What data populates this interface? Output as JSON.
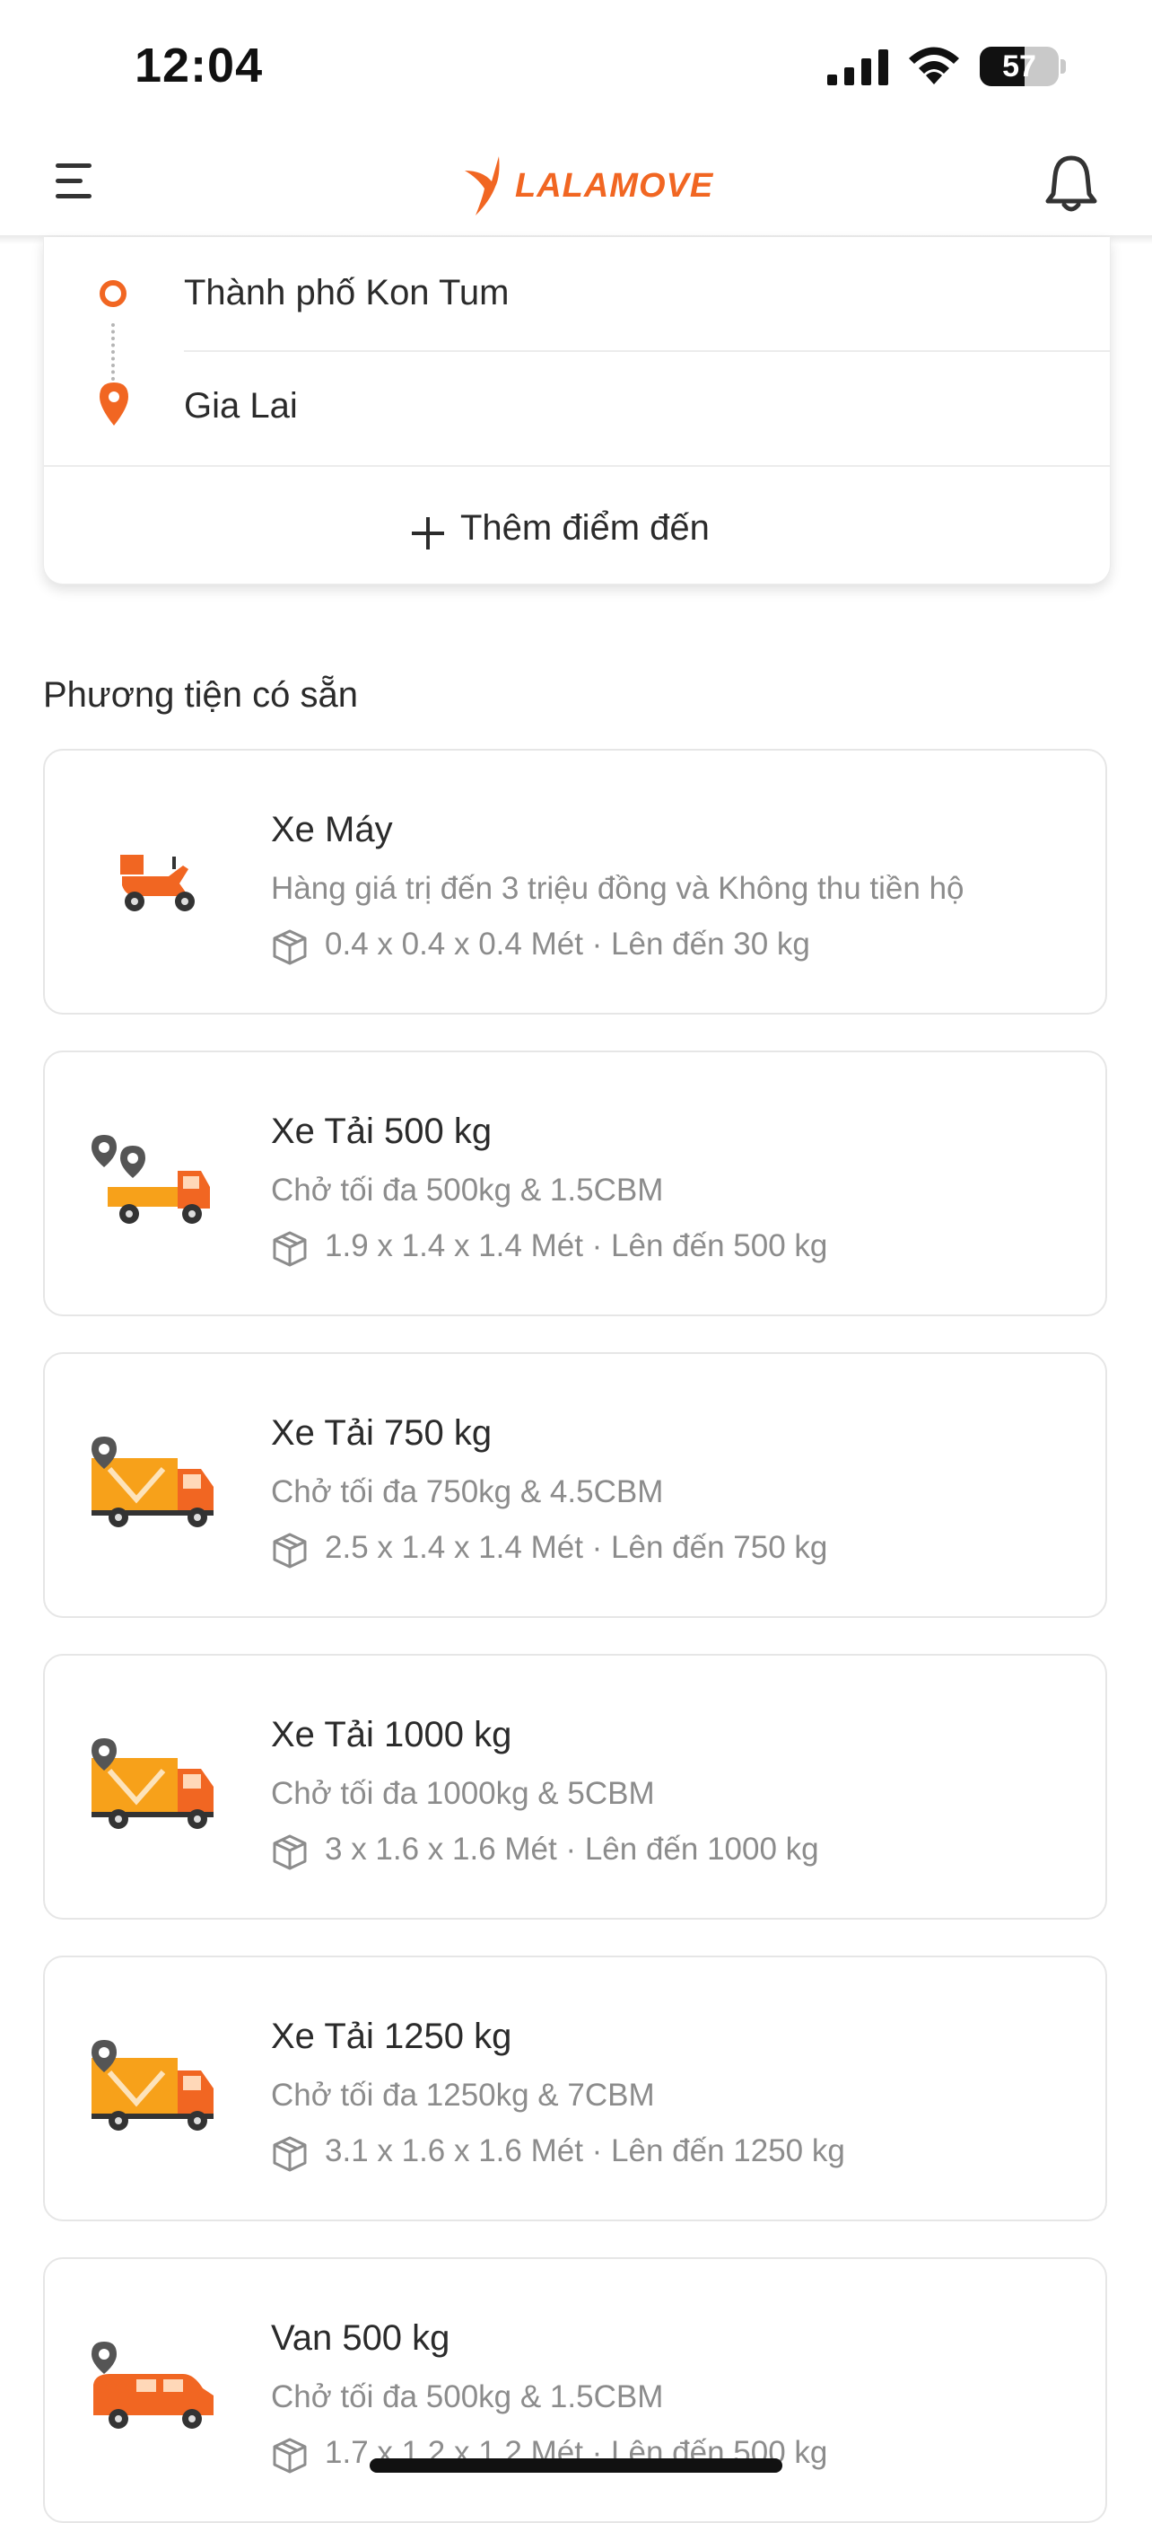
{
  "status_bar": {
    "time": "12:04",
    "battery_level": "57",
    "battery_fraction": 0.57
  },
  "header": {
    "logo_text": "LALAMOVE",
    "brand_color": "#f16622",
    "menu_icon": "hamburger-menu-icon",
    "notification_icon": "bell-icon"
  },
  "route": {
    "pickup": "Thành phố Kon Tum",
    "dropoff": "Gia Lai",
    "add_stop_icon": "plus-icon",
    "add_stop_label": "Thêm điểm đến"
  },
  "section_title": "Phương tiện có sẵn",
  "vehicles": [
    {
      "name": "Xe Máy",
      "desc": "Hàng giá trị đến 3 triệu đồng và Không thu tiền hộ",
      "dims": "0.4 x 0.4 x 0.4 Mét · Lên đến 30 kg",
      "icon": "motorbike-icon"
    },
    {
      "name": "Xe Tải 500 kg",
      "desc": "Chở tối đa 500kg & 1.5CBM",
      "dims": "1.9 x 1.4 x 1.4 Mét · Lên đến 500 kg",
      "icon": "truck-500-icon"
    },
    {
      "name": "Xe Tải 750 kg",
      "desc": "Chở tối đa 750kg & 4.5CBM",
      "dims": "2.5 x 1.4 x 1.4 Mét · Lên đến 750 kg",
      "icon": "truck-750-icon"
    },
    {
      "name": "Xe Tải 1000 kg",
      "desc": "Chở tối đa 1000kg & 5CBM",
      "dims": "3 x 1.6 x 1.6 Mét · Lên đến 1000 kg",
      "icon": "truck-1000-icon"
    },
    {
      "name": "Xe Tải 1250 kg",
      "desc": "Chở tối đa 1250kg & 7CBM",
      "dims": "3.1 x 1.6 x 1.6 Mét · Lên đến 1250 kg",
      "icon": "truck-1250-icon"
    },
    {
      "name": "Van 500 kg",
      "desc": "Chở tối đa 500kg & 1.5CBM",
      "dims": "1.7 x 1.2 x 1.2 Mét · Lên đến 500 kg",
      "icon": "van-500-icon"
    }
  ]
}
